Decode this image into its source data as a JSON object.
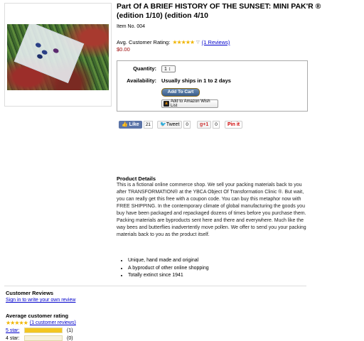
{
  "product": {
    "title": "Part Of A BRIEF HISTORY OF THE SUNSET: MINI PAK'R ® (edition 1/10) (edition 4/10",
    "item_no": "Item No.  004",
    "rating_label": "Avg. Customer Rating:",
    "rating_stars": "★★★★★",
    "rating_link": "(1 Reviews)",
    "price": "$0.00"
  },
  "buybox": {
    "quantity_label": "Quantity:",
    "quantity_value": "1 ↕",
    "availability_label": "Availability:",
    "availability_value": "Usually ships in 1 to 2 days",
    "cart_button": "Add To Cart",
    "wishlist_button": "Add to Amazon Wish List",
    "amazon_glyph": "a"
  },
  "social": {
    "like_label": "Like",
    "like_count": "21",
    "tweet_label": "Tweet",
    "tweet_count": "0",
    "gplus_label": "+1",
    "gplus_count": "0",
    "pin_label": "Pin it"
  },
  "details": {
    "heading": "Product Details",
    "body": "This is a fictional online commerce shop. We sell your packing materials back to you after TRANSFORMATION® at the YBCA Object Of Transformation Clinic ®. But wait, you can really get this free with a coupon code. You can buy this metaphor now with FREE SHIPPING. In the contemporary climate of global manufacturing the goods you buy have been packaged and repackaged dozens of times before you purchase them. Packing materials are byproducts sent here and there and everywhere. Much like the way bees and butterflies inadvertently move pollen. We offer to send you your packing materials back to you as the product itself.",
    "bullets": [
      "Unique, hand made and original",
      "A byproduct of other online shopping",
      "Totally extinct since 1941"
    ]
  },
  "reviews": {
    "heading": "Customer Reviews",
    "write_link": "Sign in to write your own review",
    "avg_heading": "Average customer rating",
    "avg_stars": "★★★★★",
    "avg_link": "(1 customer reviews)",
    "bars": [
      {
        "label": "5 star:",
        "fraction": 1.0,
        "count": "(1)"
      },
      {
        "label": "4 star:",
        "fraction": 0.0,
        "count": "(0)"
      }
    ]
  },
  "colors": {
    "link": "#0000cc",
    "star": "#f0b400",
    "price": "#990000",
    "bar_fill": "#f3c620"
  }
}
